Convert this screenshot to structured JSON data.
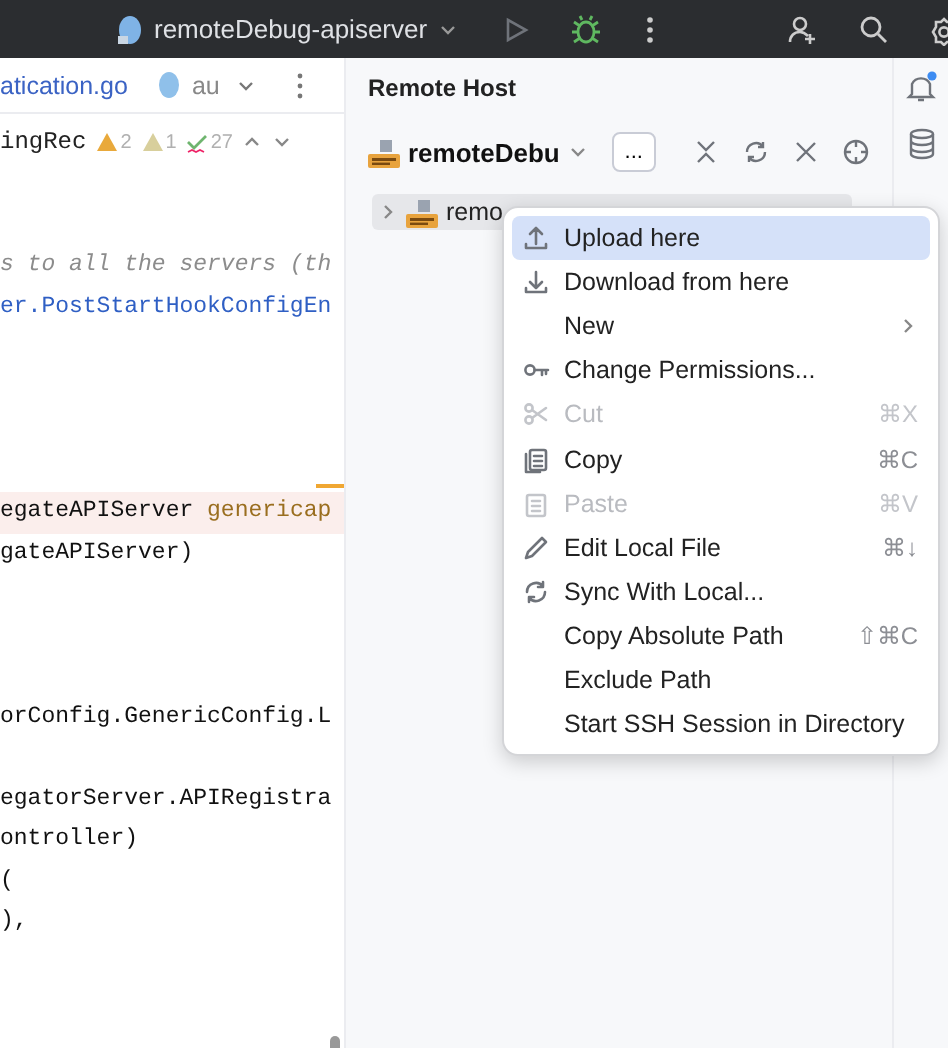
{
  "toolbar": {
    "run_config": "remoteDebug-apiserver"
  },
  "editor": {
    "tabs": [
      {
        "label": "atication.go",
        "selected": true
      },
      {
        "label": "au",
        "selected": false
      }
    ],
    "breadcrumb": "ingRec",
    "inspections": [
      {
        "kind": "warning",
        "count": "2"
      },
      {
        "kind": "weak",
        "count": "1"
      },
      {
        "kind": "typo",
        "count": "27"
      }
    ],
    "lines": [
      {
        "kind": "comment",
        "text": "s to all the servers (th"
      },
      {
        "kind": "call",
        "text": "er.PostStartHookConfigEn"
      },
      {
        "kind": "blank"
      },
      {
        "kind": "blank"
      },
      {
        "kind": "blank"
      },
      {
        "kind": "blank"
      },
      {
        "kind": "highlight",
        "text": "egateAPIServer",
        "extra": "genericap"
      },
      {
        "kind": "plain",
        "text": "gateAPIServer)"
      },
      {
        "kind": "blank"
      },
      {
        "kind": "blank"
      },
      {
        "kind": "blank"
      },
      {
        "kind": "plain",
        "text": "orConfig.GenericConfig.L"
      },
      {
        "kind": "blank"
      },
      {
        "kind": "plain",
        "text": "egatorServer.APIRegistra"
      },
      {
        "kind": "plain",
        "text": "ontroller)"
      },
      {
        "kind": "plain",
        "text": "("
      },
      {
        "kind": "plain",
        "text": "),"
      }
    ]
  },
  "remote_host": {
    "title": "Remote Host",
    "server": "remoteDebu",
    "more_button": "...",
    "tree": [
      {
        "label": "remo",
        "selected": true,
        "expanded": false
      }
    ]
  },
  "context_menu": [
    {
      "label": "Upload here",
      "selected": true,
      "disabled": false
    },
    {
      "label": "Download from here",
      "selected": false,
      "disabled": false
    },
    {
      "label": "New",
      "selected": false,
      "disabled": false,
      "submenu": true
    },
    {
      "label": "Change Permissions...",
      "selected": false,
      "disabled": false
    },
    {
      "label": "Cut",
      "shortcut": "⌘X",
      "selected": false,
      "disabled": true
    },
    {
      "label": "Copy",
      "shortcut": "⌘C",
      "selected": false,
      "disabled": false
    },
    {
      "label": "Paste",
      "shortcut": "⌘V",
      "selected": false,
      "disabled": true
    },
    {
      "label": "Edit Local File",
      "shortcut": "⌘↓",
      "selected": false,
      "disabled": false
    },
    {
      "label": "Sync With Local...",
      "selected": false,
      "disabled": false
    },
    {
      "label": "Copy Absolute Path",
      "shortcut": "⇧⌘C",
      "selected": false,
      "disabled": false
    },
    {
      "label": "Exclude Path",
      "selected": false,
      "disabled": false
    },
    {
      "label": "Start SSH Session in Directory",
      "selected": false,
      "disabled": false
    }
  ]
}
